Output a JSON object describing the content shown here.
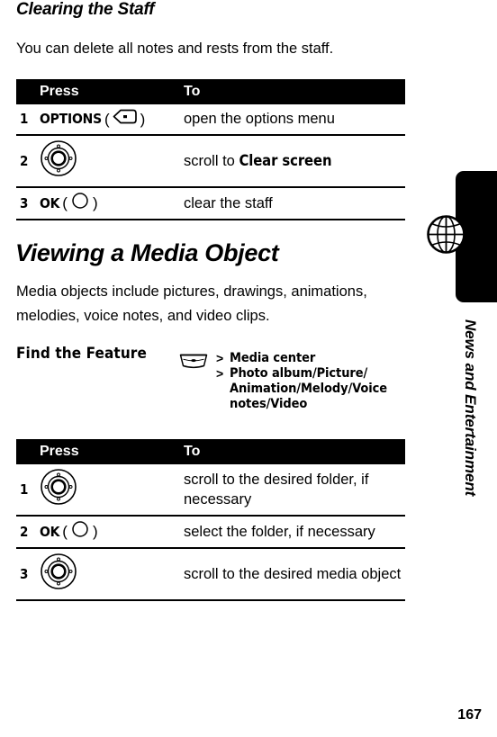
{
  "page": {
    "number": "167",
    "side_tab_title": "News and Entertainment",
    "side_tab_icon": "globe-icon"
  },
  "sections": [
    {
      "heading": "Clearing the Staff",
      "intro": "You can delete all notes and rests from the staff.",
      "table": {
        "headers": {
          "num": "",
          "press": "Press",
          "to": "To"
        },
        "rows": [
          {
            "num": "1",
            "press_label": "OPTIONS",
            "press_icon": "left-soft-key-icon",
            "to_prefix": "open the options menu",
            "to_term": "",
            "to_suffix": ""
          },
          {
            "num": "2",
            "press_label": "",
            "press_icon": "navigation-wheel-icon",
            "to_prefix": "scroll to ",
            "to_term": "Clear screen",
            "to_suffix": ""
          },
          {
            "num": "3",
            "press_label": "OK",
            "press_icon": "center-select-key-icon",
            "to_prefix": "clear the staff",
            "to_term": "",
            "to_suffix": ""
          }
        ]
      }
    },
    {
      "heading": "Viewing a Media Object",
      "intro_line1": "Media objects include pictures, drawings, animations,",
      "intro_line2": "melodies, voice notes, and video clips.",
      "find_the_feature": {
        "label": "Find the Feature",
        "icon": "menu-key-icon",
        "lines": [
          {
            "gt": ">",
            "text": "Media center",
            "indent": false
          },
          {
            "gt": ">",
            "text": "Photo album/Picture/",
            "indent": false
          },
          {
            "gt": "",
            "text": "Animation/Melody/Voice",
            "indent": true
          },
          {
            "gt": "",
            "text": "notes/Video",
            "indent": true
          }
        ]
      },
      "table": {
        "headers": {
          "num": "",
          "press": "Press",
          "to": "To"
        },
        "rows": [
          {
            "num": "1",
            "press_label": "",
            "press_icon": "navigation-wheel-icon",
            "to_prefix": "scroll to the desired folder, if necessary",
            "to_term": "",
            "to_suffix": ""
          },
          {
            "num": "2",
            "press_label": "OK",
            "press_icon": "center-select-key-icon",
            "to_prefix": "select the folder, if necessary",
            "to_term": "",
            "to_suffix": ""
          },
          {
            "num": "3",
            "press_label": "",
            "press_icon": "navigation-wheel-icon",
            "to_prefix": "scroll to the desired media object",
            "to_term": "",
            "to_suffix": ""
          }
        ]
      }
    }
  ],
  "colors": {
    "header_bar": "#000000",
    "text": "#000000",
    "background": "#ffffff"
  }
}
